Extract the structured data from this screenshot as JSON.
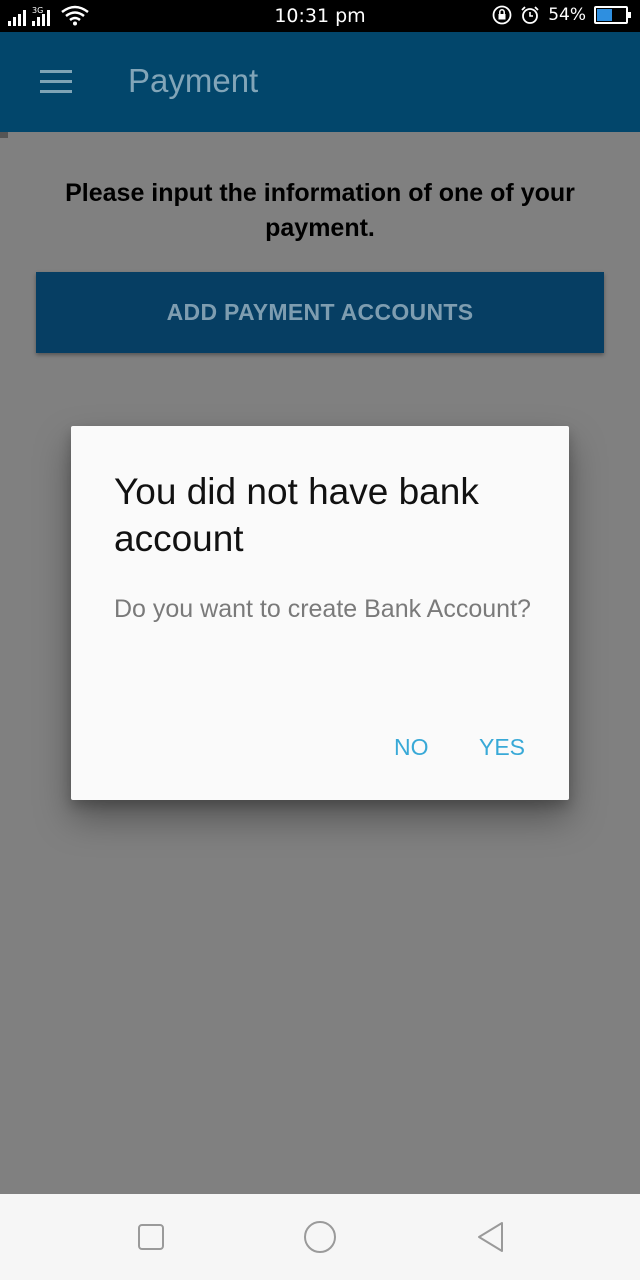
{
  "status_bar": {
    "network_label": "3G",
    "time": "10:31 pm",
    "battery_percent": "54%",
    "battery_level": 0.54,
    "icons": [
      "signal-icon",
      "wifi-icon",
      "lock-icon",
      "alarm-icon",
      "battery-icon"
    ]
  },
  "app_bar": {
    "title": "Payment",
    "menu_icon": "hamburger-menu-icon"
  },
  "content": {
    "prompt": "Please input the information of one of your payment.",
    "add_button_label": "ADD PAYMENT ACCOUNTS"
  },
  "dialog": {
    "title": "You did not have bank account",
    "message": "Do you want to create Bank Account?",
    "no_label": "NO",
    "yes_label": "YES"
  },
  "nav_bar": {
    "icons": [
      "recent-apps-icon",
      "home-icon",
      "back-icon"
    ]
  },
  "colors": {
    "app_bar": "#02466b",
    "button": "#063e63",
    "dialog_action": "#38a9d7",
    "scrim_background": "#808080"
  }
}
